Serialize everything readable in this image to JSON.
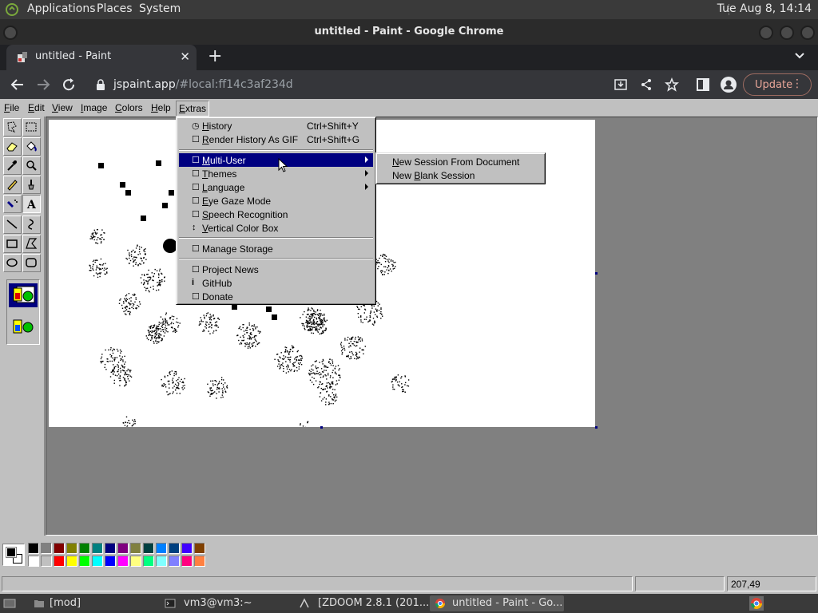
{
  "gnome_panel": {
    "menus": [
      "Applications",
      "Places",
      "System"
    ],
    "clock": "Tue Aug  8, 14:14"
  },
  "window": {
    "title": "untitled - Paint - Google Chrome"
  },
  "browser": {
    "tab_title": "untitled - Paint",
    "url_host": "jspaint.app",
    "url_rest": "/#local:ff14c3af234d",
    "update_label": "Update"
  },
  "paint": {
    "menubar": [
      "File",
      "Edit",
      "View",
      "Image",
      "Colors",
      "Help",
      "Extras"
    ],
    "active_menu": "Extras",
    "extras_menu": {
      "history": {
        "icon": "◷",
        "label": "History",
        "shortcut": "Ctrl+Shift+Y"
      },
      "render_gif": {
        "icon": "☐",
        "label": "Render History As GIF",
        "shortcut": "Ctrl+Shift+G"
      },
      "multi_user": {
        "icon": "☐",
        "label": "Multi-User"
      },
      "themes": {
        "icon": "☐",
        "label": "Themes"
      },
      "language": {
        "icon": "☐",
        "label": "Language"
      },
      "eye_gaze": {
        "icon": "☐",
        "label": "Eye Gaze Mode"
      },
      "speech": {
        "icon": "☐",
        "label": "Speech Recognition"
      },
      "vertical_color": {
        "icon": "↕",
        "label": "Vertical Color Box"
      },
      "manage_storage": {
        "icon": "☐",
        "label": "Manage Storage"
      },
      "project_news": {
        "icon": "☐",
        "label": "Project News"
      },
      "github": {
        "icon": "i",
        "label": "GitHub"
      },
      "donate": {
        "icon": "☐",
        "label": "Donate"
      }
    },
    "multi_user_submenu": {
      "new_from_doc": "New Session From Document",
      "new_blank": "New Blank Session"
    },
    "status": {
      "coords": "207,49"
    },
    "palette": {
      "row1": [
        "#000000",
        "#808080",
        "#800000",
        "#808000",
        "#008000",
        "#008080",
        "#000080",
        "#800080",
        "#808040",
        "#004040",
        "#0080ff",
        "#004080",
        "#4000ff",
        "#804000"
      ],
      "row2": [
        "#ffffff",
        "#c0c0c0",
        "#ff0000",
        "#ffff00",
        "#00ff00",
        "#00ffff",
        "#0000ff",
        "#ff00ff",
        "#ffff80",
        "#00ff80",
        "#80ffff",
        "#8080ff",
        "#ff0080",
        "#ff8040"
      ],
      "primary": "#000000",
      "secondary": "#ffffff"
    }
  },
  "taskbar": {
    "items": [
      "[mod]",
      "vm3@vm3:~",
      "[ZDOOM 2.8.1 (201...",
      "untitled - Paint - Go..."
    ]
  }
}
